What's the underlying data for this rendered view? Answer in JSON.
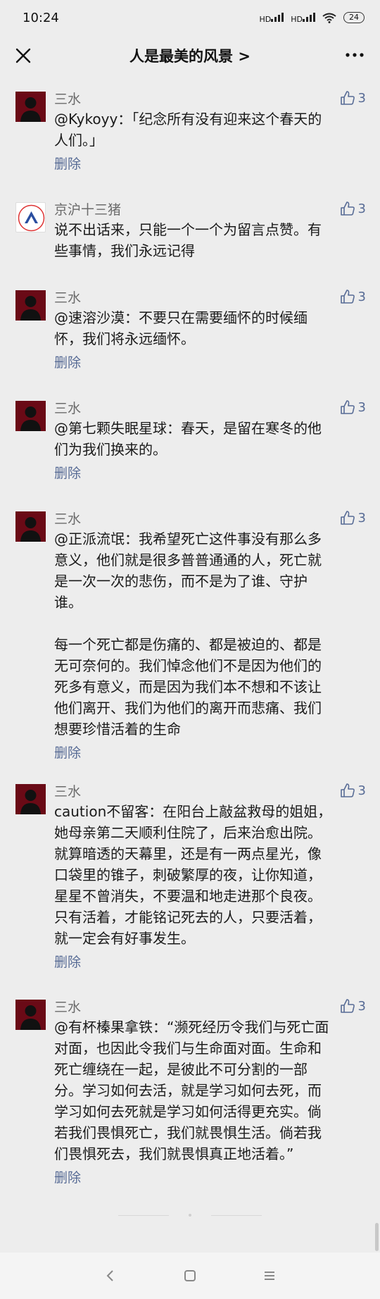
{
  "status": {
    "time": "10:24",
    "battery": "24",
    "net1": "HD",
    "net2": "HD"
  },
  "nav": {
    "title": "人是最美的风景 >"
  },
  "comments": [
    {
      "name": "三水",
      "likes": "3",
      "text": "@Kykoyy：「纪念所有没有迎来这个春天的\n人们。」",
      "delete": "删除",
      "avatar": "dark"
    },
    {
      "name": "京沪十三猪",
      "likes": "3",
      "text": "说不出话来，只能一个一个为留言点赞。有\n些事情，我们永远记得",
      "delete": "",
      "avatar": "logo"
    },
    {
      "name": "三水",
      "likes": "3",
      "text": "@速溶沙漠：不要只在需要缅怀的时候缅\n怀，我们将永远缅怀。",
      "delete": "删除",
      "avatar": "dark"
    },
    {
      "name": "三水",
      "likes": "3",
      "text": "@第七颗失眠星球：春天，是留在寒冬的他\n们为我们换来的。",
      "delete": "删除",
      "avatar": "dark"
    },
    {
      "name": "三水",
      "likes": "3",
      "text": "@正派流氓：我希望死亡这件事没有那么多\n意义，他们就是很多普普通通的人，死亡就\n是一次一次的悲伤，而不是为了谁、守护\n谁。\n\n每一个死亡都是伤痛的、都是被迫的、都是\n无可奈何的。我们悼念他们不是因为他们的\n死多有意义，而是因为我们本不想和不该让\n他们离开、我们为他们的离开而悲痛、我们\n想要珍惜活着的生命",
      "delete": "删除",
      "avatar": "dark"
    },
    {
      "name": "三水",
      "likes": "3",
      "text": "caution不留客：在阳台上敲盆救母的姐姐，\n她母亲第二天顺利住院了，后来治愈出院。\n就算暗透的天幕里，还是有一两点星光，像\n口袋里的锥子，刺破繁厚的夜，让你知道，\n星星不曾消失，不要温和地走进那个良夜。\n只有活着，才能铭记死去的人，只要活着，\n就一定会有好事发生。",
      "delete": "删除",
      "avatar": "dark"
    },
    {
      "name": "三水",
      "likes": "3",
      "text": "@有杯榛果拿铁：“濒死经历令我们与死亡面\n对面，也因此令我们与生命面对面。生命和\n死亡缠绕在一起，是彼此不可分割的一部\n分。学习如何去活，就是学习如何去死，而\n学习如何去死就是学习如何活得更充实。倘\n若我们畏惧死亡，我们就畏惧生活。倘若我\n们畏惧死去，我们就畏惧真正地活着。”",
      "delete": "删除",
      "avatar": "dark"
    }
  ]
}
